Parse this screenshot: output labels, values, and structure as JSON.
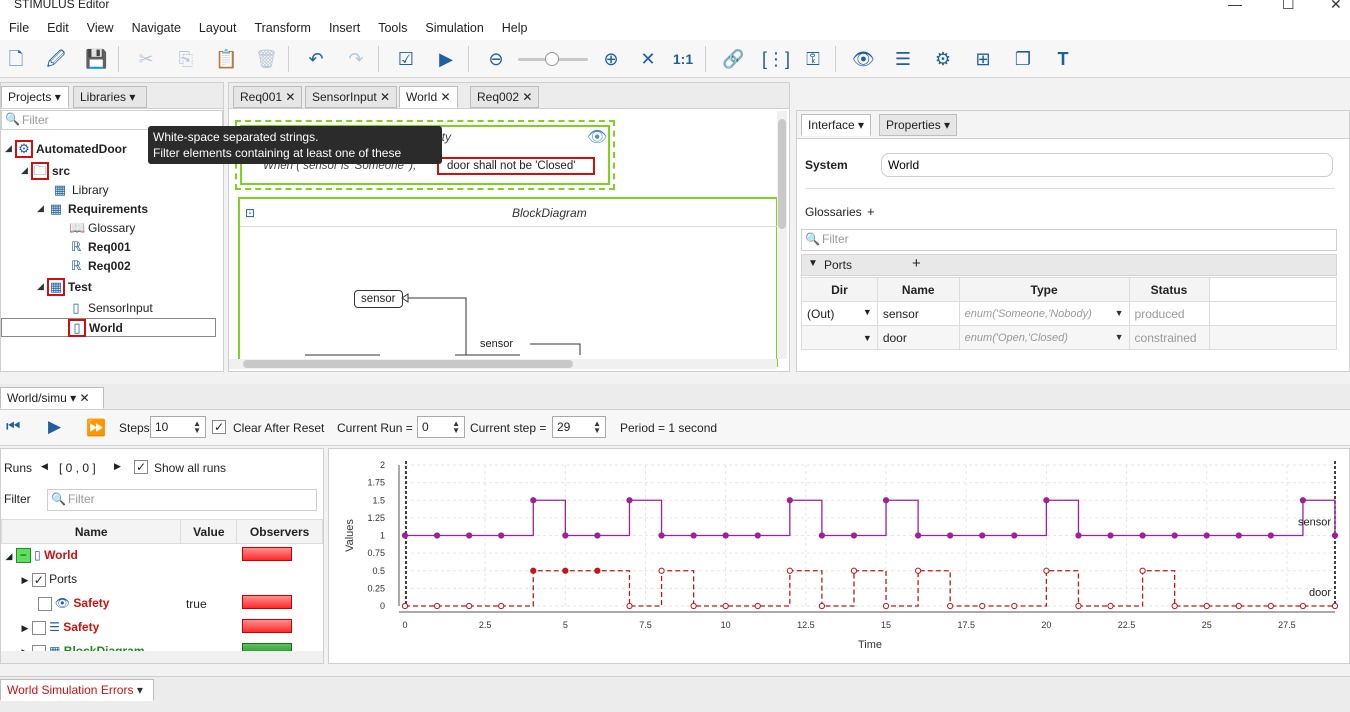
{
  "window": {
    "title": "STIMULUS Editor"
  },
  "menu": [
    "File",
    "Edit",
    "View",
    "Navigate",
    "Layout",
    "Transform",
    "Insert",
    "Tools",
    "Simulation",
    "Help"
  ],
  "toolbar": {
    "zoom_label": "1:1"
  },
  "projects": {
    "tab_projects": "Projects",
    "tab_libraries": "Libraries",
    "filter_placeholder": "Filter",
    "tree": {
      "root": "AutomatedDoor",
      "src": "src",
      "library": "Library",
      "requirements": "Requirements",
      "glossary": "Glossary",
      "req001": "Req001",
      "req002": "Req002",
      "test": "Test",
      "sensorinput": "SensorInput",
      "world": "World"
    }
  },
  "tooltip": {
    "line1": "White-space separated strings.",
    "line2": "Filter elements containing at least one of these strings."
  },
  "editor": {
    "tabs": [
      "Req001",
      "SensorInput",
      "World",
      "Req002"
    ],
    "safety_title": "Safety",
    "req_text": "When ( sensor  is  'Someone' ),",
    "req_box": "door  shall not be  'Closed'",
    "block_title": "BlockDiagram",
    "port_sensor": "sensor",
    "wire_label": "sensor"
  },
  "interface": {
    "tab_interface": "Interface",
    "tab_properties": "Properties",
    "system_label": "System",
    "system_value": "World",
    "glossaries_label": "Glossaries",
    "filter_placeholder": "Filter",
    "ports_label": "Ports",
    "headers": [
      "Dir",
      "Name",
      "Type",
      "Status"
    ],
    "rows": [
      {
        "dir": "(Out)",
        "name": "sensor",
        "type": "enum('Someone,'Nobody)",
        "status": "produced"
      },
      {
        "dir": "",
        "name": "door",
        "type": "enum('Open,'Closed)",
        "status": "constrained"
      }
    ]
  },
  "sim": {
    "tab": "World/simu",
    "steps_label": "Steps",
    "steps_value": "10",
    "clear_label": "Clear After Reset",
    "run_label": "Current Run =",
    "run_value": "0",
    "step_label": "Current step =",
    "step_value": "29",
    "period": "Period = 1 second",
    "runs_label": "Runs",
    "runs_range": "[ 0 , 0 ]",
    "show_all": "Show all runs",
    "filter_label": "Filter",
    "filter_placeholder": "Filter",
    "headers": [
      "Name",
      "Value",
      "Observers"
    ],
    "rows": [
      {
        "name": "World",
        "value": ""
      },
      {
        "name": "Ports",
        "value": ""
      },
      {
        "name": "Safety",
        "value": "true"
      },
      {
        "name": "Safety",
        "value": ""
      },
      {
        "name": "BlockDiagram",
        "value": ""
      }
    ]
  },
  "chart_data": {
    "type": "line",
    "xlabel": "Time",
    "ylabel": "Values",
    "xlim": [
      0,
      29
    ],
    "ylim": [
      0,
      2
    ],
    "xticks": [
      "0",
      "2.5",
      "5",
      "7.5",
      "10",
      "12.5",
      "15",
      "17.5",
      "20",
      "22.5",
      "25",
      "27.5"
    ],
    "yticks": [
      "0",
      "0.25",
      "0.5",
      "0.75",
      "1",
      "1.25",
      "1.5",
      "1.75",
      "2"
    ],
    "series": [
      {
        "name": "sensor",
        "style": "step",
        "color": "#a0209a",
        "x": [
          0,
          1,
          2,
          3,
          4,
          5,
          6,
          7,
          8,
          9,
          10,
          11,
          12,
          13,
          14,
          15,
          16,
          17,
          18,
          19,
          20,
          21,
          22,
          23,
          24,
          25,
          26,
          27,
          28,
          29
        ],
        "y": [
          1,
          1,
          1,
          1,
          1.5,
          1,
          1,
          1.5,
          1,
          1,
          1,
          1,
          1.5,
          1,
          1,
          1.5,
          1,
          1,
          1,
          1,
          1.5,
          1,
          1,
          1,
          1,
          1,
          1,
          1,
          1.5,
          1
        ]
      },
      {
        "name": "door",
        "style": "dashed-step",
        "color": "#c01818",
        "x": [
          0,
          1,
          2,
          3,
          4,
          5,
          6,
          7,
          8,
          9,
          10,
          11,
          12,
          13,
          14,
          15,
          16,
          17,
          18,
          19,
          20,
          21,
          22,
          23,
          24,
          25,
          26,
          27,
          28,
          29
        ],
        "y": [
          0,
          0,
          0,
          0,
          0.5,
          0.5,
          0.5,
          0,
          0.5,
          0,
          0,
          0,
          0.5,
          0,
          0.5,
          0,
          0.5,
          0,
          0,
          0,
          0.5,
          0,
          0,
          0.5,
          0,
          0,
          0,
          0,
          0,
          0
        ]
      }
    ]
  },
  "errors": {
    "tab": "World Simulation Errors"
  }
}
